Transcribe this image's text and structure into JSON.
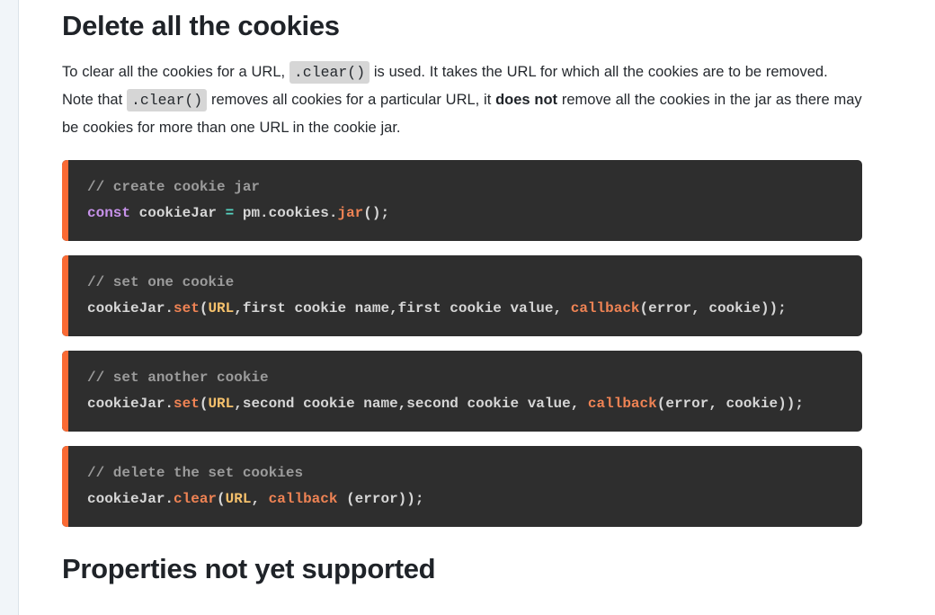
{
  "layout": {
    "accent_color": "#fb6a34",
    "code_background": "#2e2e2e",
    "page_background": "#ffffff",
    "sidebar_rail_color": "#f1f5f9",
    "heading_color": "#1f2328",
    "body_text_color": "#25292e",
    "inline_code_background": "#d6d6d6"
  },
  "article": {
    "heading": "Delete all the cookies",
    "bottom_heading": "Properties not yet supported",
    "paragraph": {
      "part1": "To clear all the cookies for a URL, ",
      "code1": ".clear()",
      "part2": " is used. It takes the URL for which all the cookies are to be removed. Note that ",
      "code2": ".clear()",
      "part3": " removes all cookies for a particular URL, it ",
      "emphasis": "does not",
      "part4": " remove all the cookies in the jar as there may be cookies for more than one URL in the cookie jar."
    },
    "code_blocks": [
      {
        "id": "create-cookie-jar",
        "comment": "// create cookie jar",
        "line_segments": [
          {
            "text": "const",
            "token": "keyword"
          },
          {
            "text": " cookieJar ",
            "token": "plain"
          },
          {
            "text": "=",
            "token": "operator"
          },
          {
            "text": " pm.cookies.",
            "token": "plain"
          },
          {
            "text": "jar",
            "token": "function"
          },
          {
            "text": "();",
            "token": "plain"
          }
        ]
      },
      {
        "id": "set-one-cookie",
        "comment": "// set one cookie",
        "line_segments": [
          {
            "text": "cookieJar.",
            "token": "plain"
          },
          {
            "text": "set",
            "token": "function"
          },
          {
            "text": "(",
            "token": "plain"
          },
          {
            "text": "URL",
            "token": "param"
          },
          {
            "text": ",first cookie name,first cookie value, ",
            "token": "plain"
          },
          {
            "text": "callback",
            "token": "function"
          },
          {
            "text": "(error, cookie));",
            "token": "plain"
          }
        ]
      },
      {
        "id": "set-another-cookie",
        "comment": "// set another cookie",
        "line_segments": [
          {
            "text": "cookieJar.",
            "token": "plain"
          },
          {
            "text": "set",
            "token": "function"
          },
          {
            "text": "(",
            "token": "plain"
          },
          {
            "text": "URL",
            "token": "param"
          },
          {
            "text": ",second cookie name,second cookie value, ",
            "token": "plain"
          },
          {
            "text": "callback",
            "token": "function"
          },
          {
            "text": "(error, cookie));",
            "token": "plain"
          }
        ]
      },
      {
        "id": "delete-set-cookies",
        "comment": "// delete the set cookies",
        "line_segments": [
          {
            "text": "cookieJar.",
            "token": "plain"
          },
          {
            "text": "clear",
            "token": "function"
          },
          {
            "text": "(",
            "token": "plain"
          },
          {
            "text": "URL",
            "token": "param"
          },
          {
            "text": ", ",
            "token": "plain"
          },
          {
            "text": "callback",
            "token": "function"
          },
          {
            "text": " (error));",
            "token": "plain"
          }
        ]
      }
    ]
  }
}
